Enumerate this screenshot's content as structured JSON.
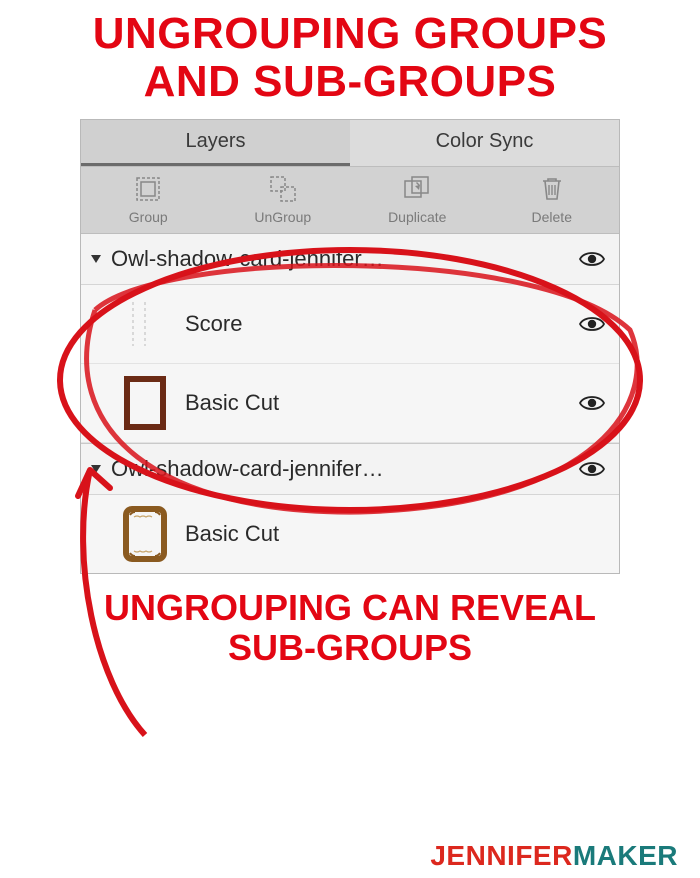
{
  "headline_line1": "UNGROUPING GROUPS",
  "headline_line2": "AND SUB-GROUPS",
  "tabs": {
    "layers": "Layers",
    "colorsync": "Color Sync"
  },
  "toolbar": {
    "group": "Group",
    "ungroup": "UnGroup",
    "duplicate": "Duplicate",
    "delete": "Delete"
  },
  "groups": [
    {
      "name": "Owl-shadow-card-jennifer…",
      "children": [
        {
          "label": "Score"
        },
        {
          "label": "Basic Cut"
        }
      ]
    },
    {
      "name": "Owl-shadow-card-jennifer…",
      "children": [
        {
          "label": "Basic Cut"
        }
      ]
    }
  ],
  "caption_line1": "UNGROUPING CAN REVEAL",
  "caption_line2": "SUB-GROUPS",
  "brand": {
    "part1": "JENNIFER",
    "part2": "MAKER"
  },
  "colors": {
    "accent_red": "#e30613",
    "frame_brown": "#6b2b15",
    "frame_tan": "#8a5a20"
  }
}
